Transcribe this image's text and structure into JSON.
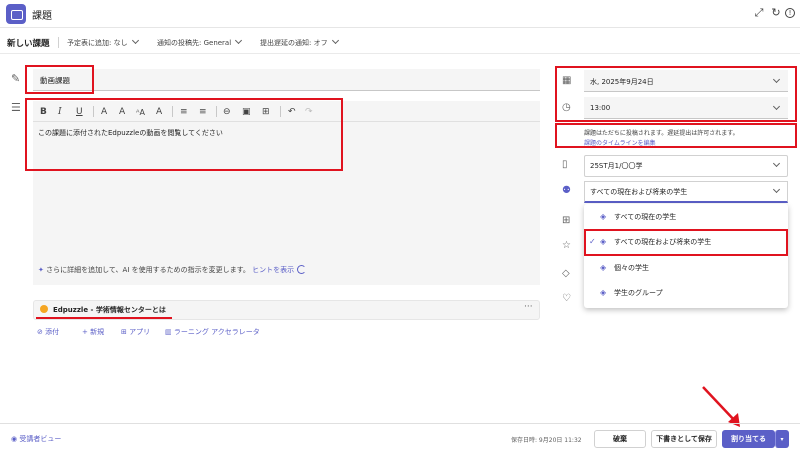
{
  "titlebar": {
    "title": "課題"
  },
  "options": {
    "heading": "新しい課題",
    "calendar": "予定表に追加: なし",
    "notify": "通知の投稿先: General",
    "late_notify": "提出遅延の通知: オフ"
  },
  "form": {
    "title_value": "動画課題",
    "instructions": "この課題に添付されたEdpuzzleの動画を閲覧してください",
    "ai_hint": "さらに詳細を追加して、AI を使用するための指示を変更します。",
    "ai_link": "ヒントを表示",
    "attachment_name": "Edpuzzle - 学術情報センターとは",
    "attachment_more": "···",
    "actions": {
      "attach": "添付",
      "new": "新規",
      "apps": "アプリ",
      "accelerator": "ラーニング アクセラレータ"
    }
  },
  "toolbar": [
    "B",
    "I",
    "U",
    "A",
    "A",
    "ᴬA",
    "A",
    "≡",
    "≡",
    "⊖",
    "▣",
    "⊞",
    "↶",
    "↷"
  ],
  "right": {
    "date": "水, 2025年9月24日",
    "time": "13:00",
    "note": "課題はただちに投稿されます。遅延提出は許可されます。",
    "note_link": "課題のタイムラインを編集",
    "points": "25ST月1/〇〇学",
    "assign_to": "すべての現在および将来の学生",
    "dropdown": [
      "すべての現在の学生",
      "すべての現在および将来の学生",
      "個々の学生",
      "学生のグループ"
    ]
  },
  "footer": {
    "preview": "受講者ビュー",
    "saved": "保存日時: 9月20日 11:32",
    "discard": "破棄",
    "save_draft": "下書きとして保存",
    "assign": "割り当てる"
  },
  "colors": {
    "accent": "#5b5fc7",
    "highlight": "#e0131f"
  }
}
